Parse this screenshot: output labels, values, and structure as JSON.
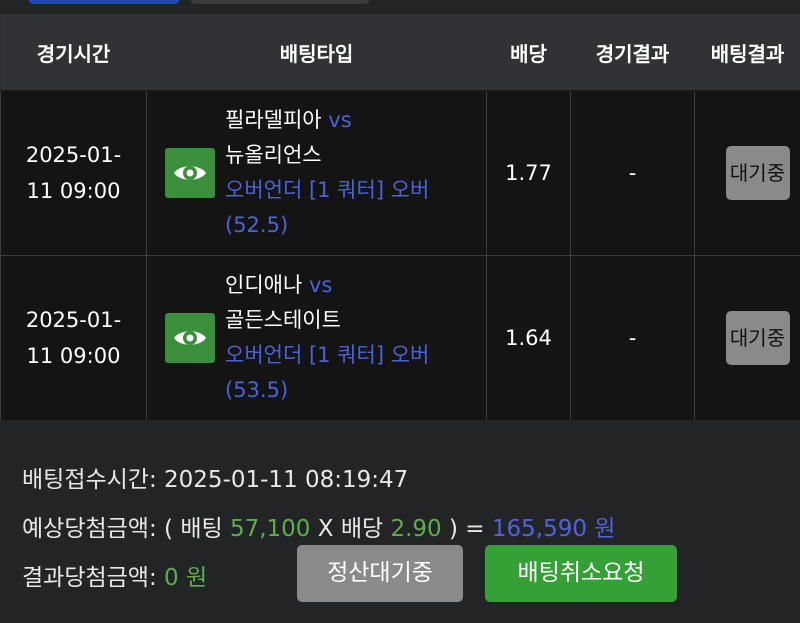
{
  "header": {
    "col_time": "경기시간",
    "col_type": "배팅타입",
    "col_odds": "배당",
    "col_game_result": "경기결과",
    "col_bet_result": "배팅결과"
  },
  "rows": [
    {
      "date": "2025-01-",
      "time": "11 09:00",
      "home": "필라델피아",
      "vs": "vs",
      "away": "뉴올리언스",
      "market": "오버언더 [1 쿼터] 오버",
      "line": "(52.5)",
      "odds": "1.77",
      "game_result": "-",
      "status": "대기중"
    },
    {
      "date": "2025-01-",
      "time": "11 09:00",
      "home": "인디애나",
      "vs": "vs",
      "away": "골든스테이트",
      "market": "오버언더 [1 쿼터] 오버",
      "line": "(53.5)",
      "odds": "1.64",
      "game_result": "-",
      "status": "대기중"
    }
  ],
  "summary": {
    "received_label": "배팅접수시간:",
    "received_value": "2025-01-11 08:19:47",
    "expected_label": "예상당첨금액:",
    "open_paren": "( 배팅",
    "bet_amount": "57,100",
    "x_label": "X 배당",
    "total_odds": "2.90",
    "close_paren": ") =",
    "expected_amount": "165,590 원",
    "result_label": "결과당첨금액:",
    "result_amount": "0 원"
  },
  "buttons": {
    "settle_pending": "정산대기중",
    "cancel_request": "배팅취소요청"
  },
  "colors": {
    "accent_blue": "#4b63d9",
    "accent_green": "#5fae4d",
    "button_green": "#35a035",
    "button_gray": "#8a8a8a"
  },
  "icons": {
    "detail": "eye-icon"
  }
}
